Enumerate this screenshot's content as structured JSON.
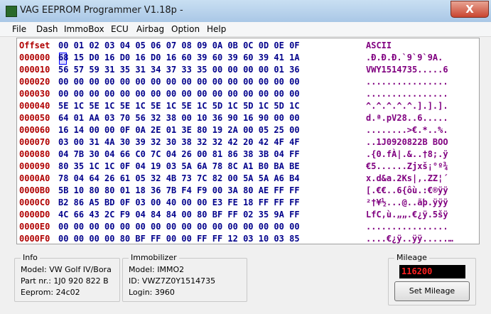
{
  "window": {
    "title": "VAG EEPROM Programmer  V1.18p -",
    "close_glyph": "X"
  },
  "menu": [
    "File",
    "Dash",
    "ImmoBox",
    "ECU",
    "Airbag",
    "Option",
    "Help"
  ],
  "hex": {
    "offset_header": "Offset",
    "columns": "00 01 02 03 04 05 06 07 08 09 0A 0B 0C 0D 0E 0F",
    "ascii_header": "ASCII",
    "rows": [
      {
        "addr": "000000",
        "bytes": "68 15 D0 16 D0 16 D0 16 60 39 60 39 60 39 41 1A",
        "ascii": ".Ð.Ð.Ð.`9`9`9A."
      },
      {
        "addr": "000010",
        "bytes": "56 57 59 31 35 31 34 37 33 35 00 00 00 00 01 36",
        "ascii": "VWY1514735.....6"
      },
      {
        "addr": "000020",
        "bytes": "00 00 00 00 00 00 00 00 00 00 00 00 00 00 00 00",
        "ascii": "................"
      },
      {
        "addr": "000030",
        "bytes": "00 00 00 00 00 00 00 00 00 00 00 00 00 00 00 00",
        "ascii": "................"
      },
      {
        "addr": "000040",
        "bytes": "5E 1C 5E 1C 5E 1C 5E 1C 5E 1C 5D 1C 5D 1C 5D 1C",
        "ascii": "^.^.^.^.^.].].]."
      },
      {
        "addr": "000050",
        "bytes": "64 01 AA 03 70 56 32 38 00 10 36 90 16 90 00 00",
        "ascii": "d.ª.pV28..6....."
      },
      {
        "addr": "000060",
        "bytes": "16 14 00 00 0F 0A 2E 01 3E 80 19 2A 00 05 25 00",
        "ascii": "........>€.*..%."
      },
      {
        "addr": "000070",
        "bytes": "03 00 31 4A 30 39 32 30 38 32 32 42 20 42 4F 4F",
        "ascii": "..1J0920822B BOO"
      },
      {
        "addr": "000080",
        "bytes": "04 7B 30 04 66 C0 7C 04 26 00 81 86 38 3B 04 FF",
        "ascii": ".{0.fÀ|.&..†8;.ÿ"
      },
      {
        "addr": "000090",
        "bytes": "80 35 1C 1C 0F 04 19 03 5A 6A 78 8C A1 B0 BA BE",
        "ascii": "€5......Zjxš¡°º¾"
      },
      {
        "addr": "0000A0",
        "bytes": "78 04 64 26 61 05 32 4B 73 7C 82 00 5A 5A A6 B4",
        "ascii": "x.d&a.2Ks|‚.ZZ¦´"
      },
      {
        "addr": "0000B0",
        "bytes": "5B 10 80 80 01 18 36 7B F4 F9 00 3A 80 AE FF FF",
        "ascii": "[.€€..6{ôù.:€®ÿÿ"
      },
      {
        "addr": "0000C0",
        "bytes": "B2 86 A5 BD 0F 03 00 40 00 00 E3 FE 18 FF FF FF",
        "ascii": "²†¥½...@..ãþ.ÿÿÿ"
      },
      {
        "addr": "0000D0",
        "bytes": "4C 66 43 2C F9 04 84 84 00 80 BF FF 02 35 9A FF",
        "ascii": "LfC,ù.„„.€¿ÿ.5šÿ"
      },
      {
        "addr": "0000E0",
        "bytes": "00 00 00 00 00 00 00 00 00 00 00 00 00 00 00 00",
        "ascii": "................"
      },
      {
        "addr": "0000F0",
        "bytes": "00 00 00 00 80 BF FF 00 00 FF FF 12 03 10 03 85",
        "ascii": "....€¿ÿ..ÿÿ.....…"
      }
    ]
  },
  "info": {
    "title": "Info",
    "model": "Model:   VW Golf IV/Bora",
    "part": "Part nr.: 1J0 920 822 B",
    "eeprom": "Eeprom: 24c02"
  },
  "immobilizer": {
    "title": "Immobilizer",
    "model": "Model:   IMMO2",
    "id": "ID: VWZ7Z0Y1514735",
    "login": "Login: 3960"
  },
  "mileage": {
    "title": "Mileage",
    "value": "116200",
    "button": "Set Mileage"
  },
  "colors": {
    "address": "#b00000",
    "bytes": "#00008b",
    "ascii": "#800080",
    "mileage_text": "#ff2020"
  }
}
